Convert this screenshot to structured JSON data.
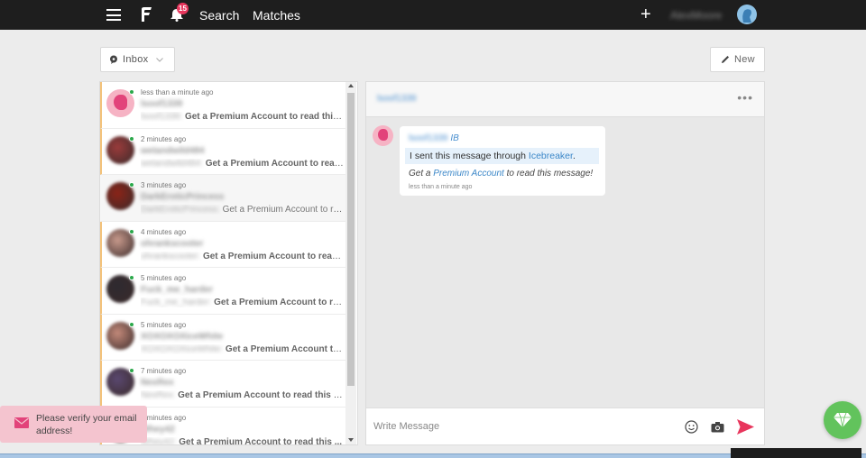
{
  "topbar": {
    "notification_count": "15",
    "nav": {
      "search": "Search",
      "matches": "Matches"
    },
    "username": "AlexMoore"
  },
  "inbox": {
    "folder_label": "Inbox",
    "new_label": "New"
  },
  "conversations": [
    {
      "time": "less than a minute ago",
      "name": "lsoof1339",
      "sender": "lsoof1339:",
      "preview": "Get a Premium Account to read this ...",
      "unread": true,
      "online": true
    },
    {
      "time": "2 minutes ago",
      "name": "wetandwild484",
      "sender": "wetandwild484:",
      "preview": "Get a Premium Account to read ...",
      "unread": true,
      "online": true
    },
    {
      "time": "3 minutes ago",
      "name": "DarkEroticPrincess",
      "sender": "DarkEroticPrincess:",
      "preview": "Get a Premium Account to read...",
      "unread": false,
      "online": true
    },
    {
      "time": "4 minutes ago",
      "name": "ohrankscooter",
      "sender": "ohrankscooter:",
      "preview": "Get a Premium Account to read ...",
      "unread": true,
      "online": true
    },
    {
      "time": "5 minutes ago",
      "name": "Fuck_me_harder",
      "sender": "Fuck_me_harder:",
      "preview": "Get a Premium Account to rea...",
      "unread": true,
      "online": true
    },
    {
      "time": "5 minutes ago",
      "name": "XOXOXOXiceWhite",
      "sender": "XOXOXOXiceWhite:",
      "preview": "Get a Premium Account to re...",
      "unread": true,
      "online": true
    },
    {
      "time": "7 minutes ago",
      "name": "NexRex",
      "sender": "NexRex:",
      "preview": "Get a Premium Account to read this m...",
      "unread": true,
      "online": true
    },
    {
      "time": "8 minutes ago",
      "name": "Whey42",
      "sender": "Whey42:",
      "preview": "Get a Premium Account to read this ...",
      "unread": true,
      "online": false
    }
  ],
  "chat": {
    "title": "lsoof1339",
    "more_label": "•••",
    "message": {
      "sender": "lsoof1339",
      "tag": "IB",
      "icebreaker_prefix": "I sent this message through ",
      "icebreaker_link": "Icebreaker",
      "icebreaker_suffix": ".",
      "premium_prefix": "Get a ",
      "premium_link": "Premium Account",
      "premium_suffix": " to read this message!",
      "time": "less than a minute ago"
    },
    "composer": {
      "placeholder": "Write Message",
      "value": ""
    }
  },
  "toast": {
    "text": "Please verify your email address!"
  },
  "colors": {
    "accent_pink": "#e8365d",
    "link_blue": "#3b87c8",
    "online_green": "#2aa84a",
    "premium_green": "#62c35c",
    "unread_border": "#f3c27a"
  }
}
